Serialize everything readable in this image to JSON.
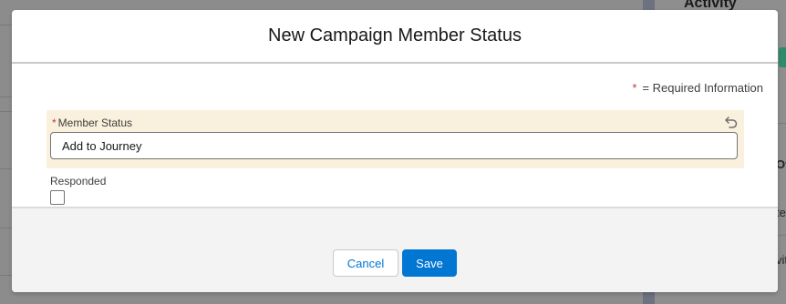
{
  "background": {
    "panel_heading": "Activity",
    "right_fragments": [
      "Ov",
      "te",
      "vit"
    ]
  },
  "modal": {
    "title": "New Campaign Member Status",
    "required_note": "= Required Information",
    "required_marker": "*",
    "fields": {
      "member_status": {
        "label": "Member Status",
        "value": "Add to Journey",
        "required": true
      },
      "responded": {
        "label": "Responded",
        "checked": false
      }
    },
    "footer": {
      "cancel_label": "Cancel",
      "save_label": "Save"
    }
  },
  "colors": {
    "brand": "#0176d3",
    "required": "#c23934",
    "edited_field_bg": "#faf0de"
  },
  "icons": {
    "undo": "undo-icon"
  }
}
